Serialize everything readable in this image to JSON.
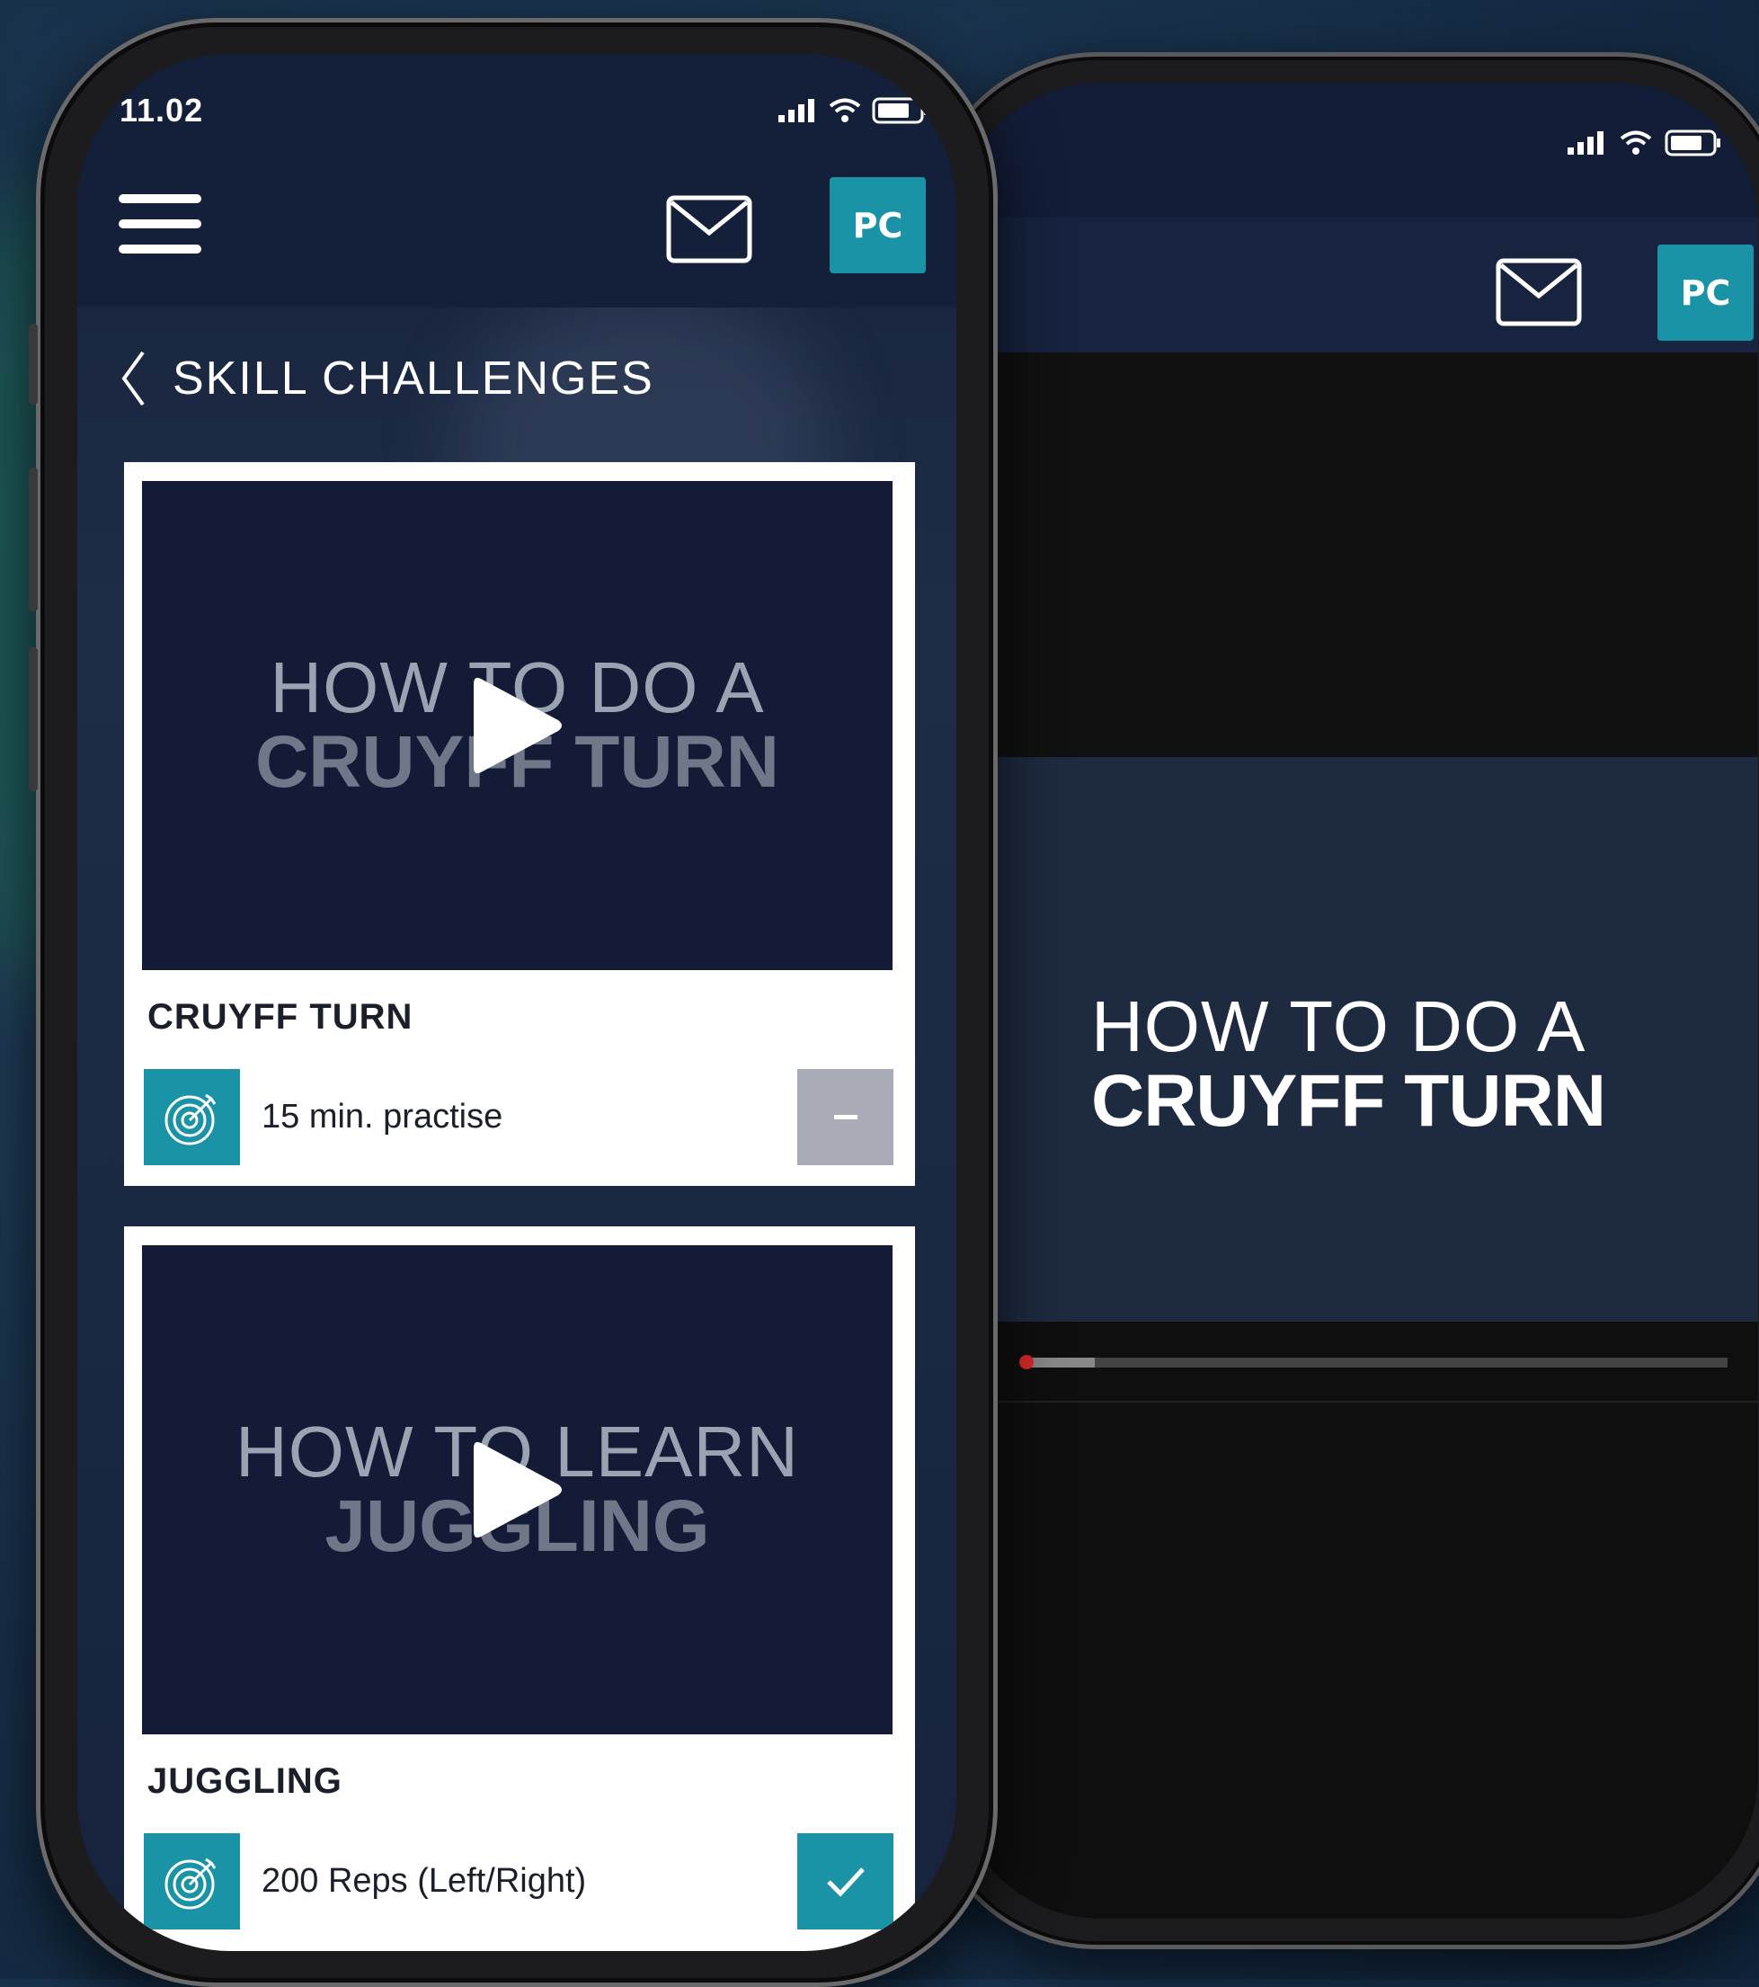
{
  "status_bar": {
    "time": "11.02"
  },
  "header": {
    "avatar_initials": "PC"
  },
  "page": {
    "title": "SKILL CHALLENGES"
  },
  "challenges": [
    {
      "video_title_line1": "HOW TO DO A",
      "video_title_line2": "CRUYFF TURN",
      "name": "CRUYFF TURN",
      "goal": "15 min. practise",
      "status": "incomplete",
      "status_symbol": "–"
    },
    {
      "video_title_line1": "HOW TO LEARN",
      "video_title_line2": "JUGGLING",
      "name": "JUGGLING",
      "goal": "200 Reps (Left/Right)",
      "status": "complete",
      "status_symbol": "✓"
    }
  ],
  "video_player": {
    "avatar_initials": "PC",
    "title_line1": "HOW TO DO A",
    "title_line2": "CRUYFF TURN",
    "progress": 0.1
  },
  "colors": {
    "accent": "#1a93a6",
    "header_bg": "#141f3a",
    "video_bg": "#141b37",
    "incomplete_btn": "#a9abb7"
  },
  "icons": [
    "menu-icon",
    "mail-icon",
    "back-chevron-icon",
    "play-icon",
    "target-icon",
    "minus-icon",
    "check-icon",
    "signal-icon",
    "wifi-icon",
    "battery-icon"
  ]
}
